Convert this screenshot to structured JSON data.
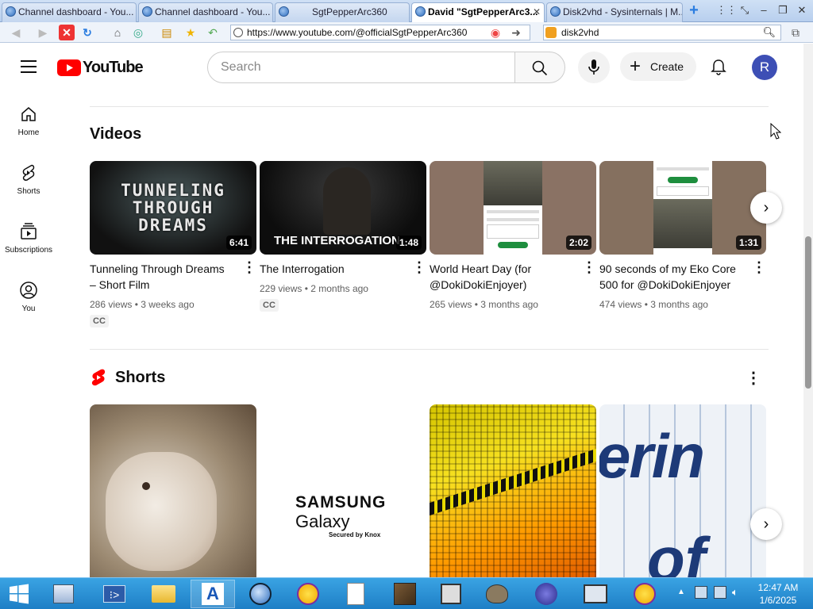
{
  "browser": {
    "tabs": [
      {
        "label": "Channel dashboard - You...",
        "active": false
      },
      {
        "label": "Channel dashboard - You...",
        "active": false
      },
      {
        "label": "SgtPepperArc360",
        "active": false
      },
      {
        "label": "David \"SgtPepperArc3...",
        "active": true
      },
      {
        "label": "Disk2vhd - Sysinternals | M...",
        "active": false
      }
    ],
    "url": "https://www.youtube.com/@officialSgtPepperArc360",
    "search_value": "disk2vhd"
  },
  "youtube": {
    "logo_text": "YouTube",
    "search_placeholder": "Search",
    "create_label": "Create",
    "avatar_letter": "R",
    "brand_color": "#ff0000"
  },
  "sidebar": {
    "items": [
      {
        "label": "Home",
        "icon": "home-icon"
      },
      {
        "label": "Shorts",
        "icon": "shorts-icon"
      },
      {
        "label": "Subscriptions",
        "icon": "subscriptions-icon"
      },
      {
        "label": "You",
        "icon": "you-icon"
      }
    ]
  },
  "videos_section": {
    "heading": "Videos",
    "videos": [
      {
        "title": "Tunneling Through Dreams – Short Film",
        "duration": "6:41",
        "views": "286 views",
        "age": "3 weeks ago",
        "badge": "CC",
        "thumb_text": "TUNNELING THROUGH DREAMS"
      },
      {
        "title": "The Interrogation",
        "duration": "1:48",
        "views": "229 views",
        "age": "2 months ago",
        "badge": "CC",
        "thumb_text": "THE INTERROGATION"
      },
      {
        "title": "World Heart Day (for @DokiDokiEnjoyer)",
        "duration": "2:02",
        "views": "265 views",
        "age": "3 months ago",
        "badge": ""
      },
      {
        "title": "90 seconds of my Eko Core 500 for @DokiDokiEnjoyer",
        "duration": "1:31",
        "views": "474 views",
        "age": "3 months ago",
        "badge": ""
      }
    ]
  },
  "shorts_section": {
    "heading": "Shorts",
    "shorts": [
      {
        "thumb": "puppy-photo"
      },
      {
        "brand_line1": "SAMSUNG",
        "brand_line2": "Galaxy",
        "brand_line3": "Secured by Knox"
      },
      {
        "thumb": "equalizer-graphic"
      },
      {
        "thumb_text": "erin"
      }
    ]
  },
  "taskbar": {
    "time": "12:47 AM",
    "date": "1/6/2025",
    "apps": [
      "windows-start",
      "file-explorer",
      "powershell",
      "folder",
      "app-a",
      "browser",
      "yahoo-messenger",
      "notepad",
      "minecraft",
      "media-viewer",
      "gimp",
      "bug-app",
      "monitor",
      "yahoo"
    ]
  }
}
